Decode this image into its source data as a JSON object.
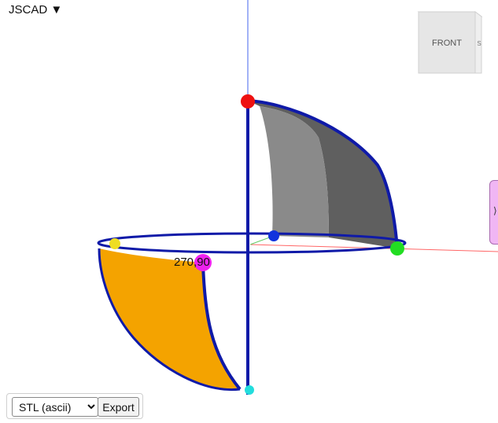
{
  "app": {
    "menu_label": "JSCAD ▼"
  },
  "view_cube": {
    "face_label": "FRONT",
    "side_label": "S"
  },
  "side_panel": {
    "toggle_glyph": "⟩"
  },
  "scene": {
    "point_label": "270,90",
    "colors": {
      "background": "#ffffff",
      "orange_surface": "#f4a300",
      "gray_surface": "#5f5f5f",
      "outline": "#0f1aa8",
      "y_axis": "#4466ee",
      "x_axis": "#ff6666",
      "z_axis": "#66cc66",
      "handle_red": "#ee1111",
      "handle_green": "#22dd22",
      "handle_blue": "#1133dd",
      "handle_magenta": "#ee22ee",
      "handle_yellow": "#eedd22",
      "handle_cyan": "#22dddd"
    }
  },
  "export": {
    "format_selected": "STL (ascii)",
    "button_label": "Export"
  }
}
